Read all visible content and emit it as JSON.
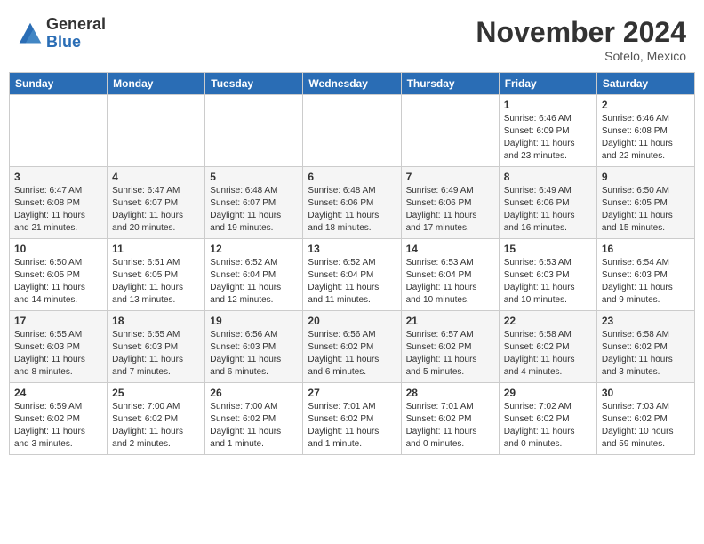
{
  "logo": {
    "general": "General",
    "blue": "Blue"
  },
  "title": "November 2024",
  "location": "Sotelo, Mexico",
  "days_of_week": [
    "Sunday",
    "Monday",
    "Tuesday",
    "Wednesday",
    "Thursday",
    "Friday",
    "Saturday"
  ],
  "weeks": [
    [
      {
        "day": "",
        "info": ""
      },
      {
        "day": "",
        "info": ""
      },
      {
        "day": "",
        "info": ""
      },
      {
        "day": "",
        "info": ""
      },
      {
        "day": "",
        "info": ""
      },
      {
        "day": "1",
        "info": "Sunrise: 6:46 AM\nSunset: 6:09 PM\nDaylight: 11 hours and 23 minutes."
      },
      {
        "day": "2",
        "info": "Sunrise: 6:46 AM\nSunset: 6:08 PM\nDaylight: 11 hours and 22 minutes."
      }
    ],
    [
      {
        "day": "3",
        "info": "Sunrise: 6:47 AM\nSunset: 6:08 PM\nDaylight: 11 hours and 21 minutes."
      },
      {
        "day": "4",
        "info": "Sunrise: 6:47 AM\nSunset: 6:07 PM\nDaylight: 11 hours and 20 minutes."
      },
      {
        "day": "5",
        "info": "Sunrise: 6:48 AM\nSunset: 6:07 PM\nDaylight: 11 hours and 19 minutes."
      },
      {
        "day": "6",
        "info": "Sunrise: 6:48 AM\nSunset: 6:06 PM\nDaylight: 11 hours and 18 minutes."
      },
      {
        "day": "7",
        "info": "Sunrise: 6:49 AM\nSunset: 6:06 PM\nDaylight: 11 hours and 17 minutes."
      },
      {
        "day": "8",
        "info": "Sunrise: 6:49 AM\nSunset: 6:06 PM\nDaylight: 11 hours and 16 minutes."
      },
      {
        "day": "9",
        "info": "Sunrise: 6:50 AM\nSunset: 6:05 PM\nDaylight: 11 hours and 15 minutes."
      }
    ],
    [
      {
        "day": "10",
        "info": "Sunrise: 6:50 AM\nSunset: 6:05 PM\nDaylight: 11 hours and 14 minutes."
      },
      {
        "day": "11",
        "info": "Sunrise: 6:51 AM\nSunset: 6:05 PM\nDaylight: 11 hours and 13 minutes."
      },
      {
        "day": "12",
        "info": "Sunrise: 6:52 AM\nSunset: 6:04 PM\nDaylight: 11 hours and 12 minutes."
      },
      {
        "day": "13",
        "info": "Sunrise: 6:52 AM\nSunset: 6:04 PM\nDaylight: 11 hours and 11 minutes."
      },
      {
        "day": "14",
        "info": "Sunrise: 6:53 AM\nSunset: 6:04 PM\nDaylight: 11 hours and 10 minutes."
      },
      {
        "day": "15",
        "info": "Sunrise: 6:53 AM\nSunset: 6:03 PM\nDaylight: 11 hours and 10 minutes."
      },
      {
        "day": "16",
        "info": "Sunrise: 6:54 AM\nSunset: 6:03 PM\nDaylight: 11 hours and 9 minutes."
      }
    ],
    [
      {
        "day": "17",
        "info": "Sunrise: 6:55 AM\nSunset: 6:03 PM\nDaylight: 11 hours and 8 minutes."
      },
      {
        "day": "18",
        "info": "Sunrise: 6:55 AM\nSunset: 6:03 PM\nDaylight: 11 hours and 7 minutes."
      },
      {
        "day": "19",
        "info": "Sunrise: 6:56 AM\nSunset: 6:03 PM\nDaylight: 11 hours and 6 minutes."
      },
      {
        "day": "20",
        "info": "Sunrise: 6:56 AM\nSunset: 6:02 PM\nDaylight: 11 hours and 6 minutes."
      },
      {
        "day": "21",
        "info": "Sunrise: 6:57 AM\nSunset: 6:02 PM\nDaylight: 11 hours and 5 minutes."
      },
      {
        "day": "22",
        "info": "Sunrise: 6:58 AM\nSunset: 6:02 PM\nDaylight: 11 hours and 4 minutes."
      },
      {
        "day": "23",
        "info": "Sunrise: 6:58 AM\nSunset: 6:02 PM\nDaylight: 11 hours and 3 minutes."
      }
    ],
    [
      {
        "day": "24",
        "info": "Sunrise: 6:59 AM\nSunset: 6:02 PM\nDaylight: 11 hours and 3 minutes."
      },
      {
        "day": "25",
        "info": "Sunrise: 7:00 AM\nSunset: 6:02 PM\nDaylight: 11 hours and 2 minutes."
      },
      {
        "day": "26",
        "info": "Sunrise: 7:00 AM\nSunset: 6:02 PM\nDaylight: 11 hours and 1 minute."
      },
      {
        "day": "27",
        "info": "Sunrise: 7:01 AM\nSunset: 6:02 PM\nDaylight: 11 hours and 1 minute."
      },
      {
        "day": "28",
        "info": "Sunrise: 7:01 AM\nSunset: 6:02 PM\nDaylight: 11 hours and 0 minutes."
      },
      {
        "day": "29",
        "info": "Sunrise: 7:02 AM\nSunset: 6:02 PM\nDaylight: 11 hours and 0 minutes."
      },
      {
        "day": "30",
        "info": "Sunrise: 7:03 AM\nSunset: 6:02 PM\nDaylight: 10 hours and 59 minutes."
      }
    ]
  ]
}
